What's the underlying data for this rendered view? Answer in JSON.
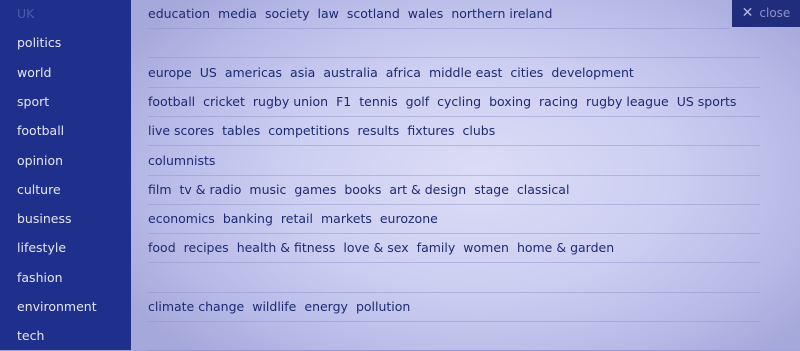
{
  "sidebar": {
    "items": [
      {
        "label": "UK",
        "active": true
      },
      {
        "label": "politics"
      },
      {
        "label": "world"
      },
      {
        "label": "sport"
      },
      {
        "label": "football"
      },
      {
        "label": "opinion"
      },
      {
        "label": "culture"
      },
      {
        "label": "business"
      },
      {
        "label": "lifestyle"
      },
      {
        "label": "fashion"
      },
      {
        "label": "environment"
      },
      {
        "label": "tech"
      }
    ]
  },
  "subnav": {
    "rows": [
      [
        "education",
        "media",
        "society",
        "law",
        "scotland",
        "wales",
        "northern ireland"
      ],
      [],
      [
        "europe",
        "US",
        "americas",
        "asia",
        "australia",
        "africa",
        "middle east",
        "cities",
        "development"
      ],
      [
        "football",
        "cricket",
        "rugby union",
        "F1",
        "tennis",
        "golf",
        "cycling",
        "boxing",
        "racing",
        "rugby league",
        "US sports"
      ],
      [
        "live scores",
        "tables",
        "competitions",
        "results",
        "fixtures",
        "clubs"
      ],
      [
        "columnists"
      ],
      [
        "film",
        "tv & radio",
        "music",
        "games",
        "books",
        "art & design",
        "stage",
        "classical"
      ],
      [
        "economics",
        "banking",
        "retail",
        "markets",
        "eurozone"
      ],
      [
        "food",
        "recipes",
        "health & fitness",
        "love & sex",
        "family",
        "women",
        "home & garden"
      ],
      [],
      [
        "climate change",
        "wildlife",
        "energy",
        "pollution"
      ],
      []
    ]
  },
  "close": {
    "icon": "close-icon",
    "glyph": "✕",
    "label": "close"
  }
}
